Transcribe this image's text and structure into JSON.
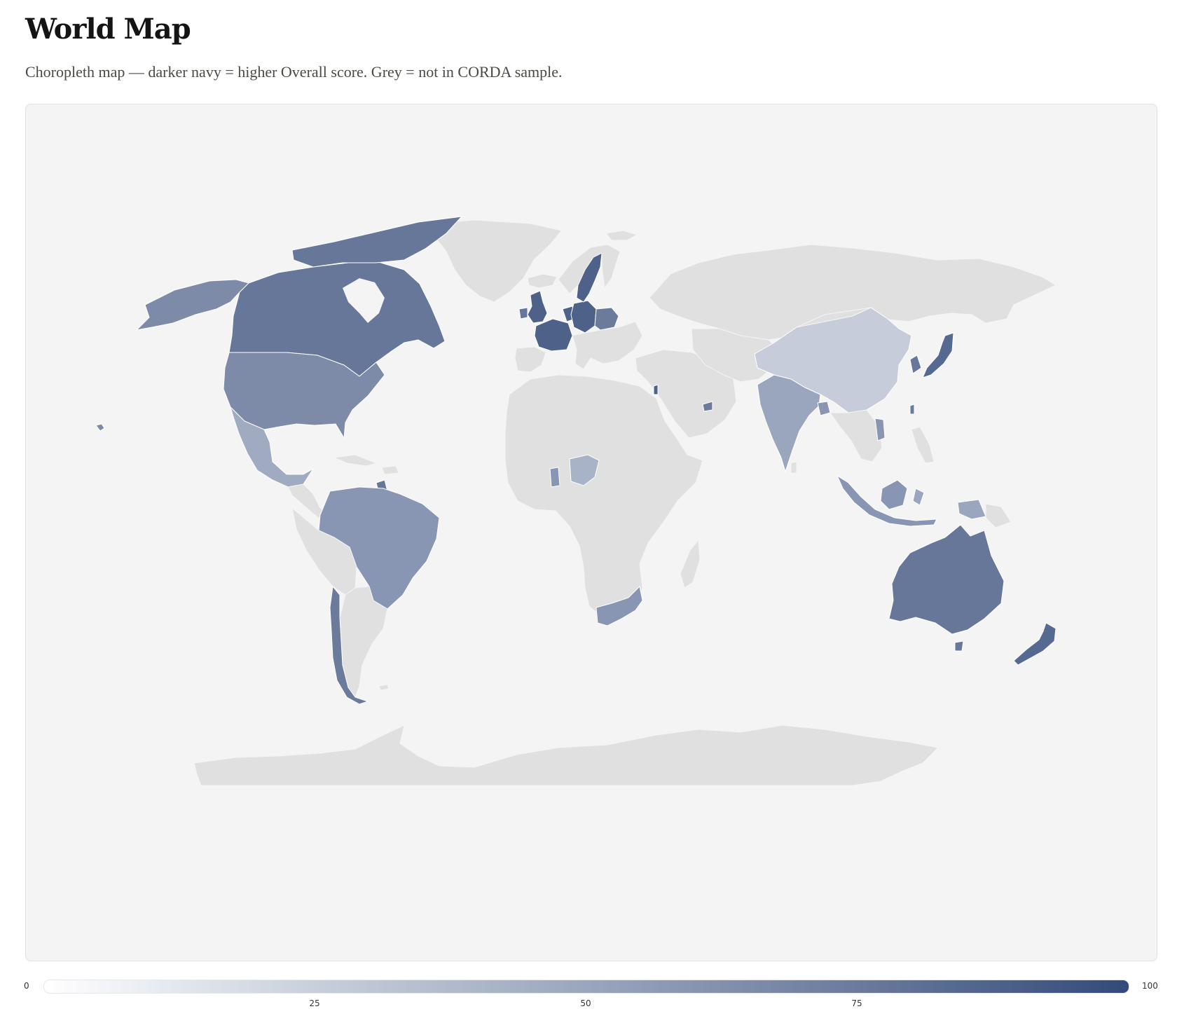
{
  "page": {
    "title": "World Map",
    "subtitle": "Choropleth map — darker navy = higher Overall score. Grey = not in CORDA sample."
  },
  "legend": {
    "min_label": "0",
    "max_label": "100",
    "ticks": [
      "25",
      "50",
      "75"
    ],
    "color_low": "#ffffff",
    "color_high": "#334a7a"
  },
  "map": {
    "type": "choropleth",
    "metric": "Overall score",
    "missing_color": "#e0e0e0",
    "background_color": "#f4f4f5"
  }
}
